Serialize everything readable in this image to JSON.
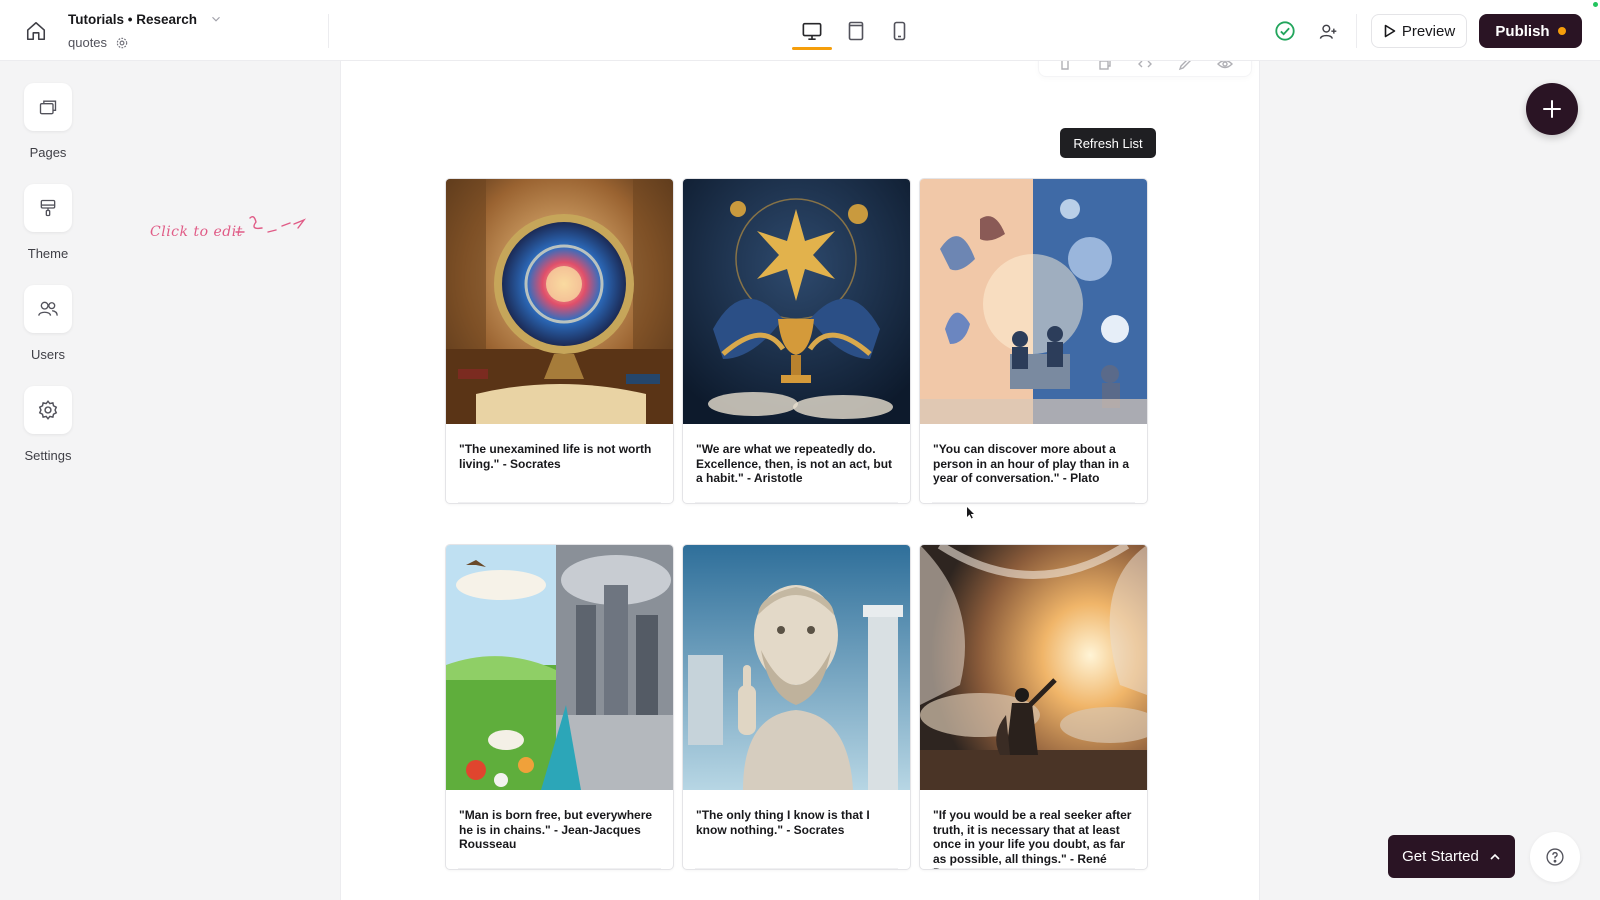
{
  "header": {
    "project_name": "Tutorials • Research",
    "app_name": "quotes",
    "preview_label": "Preview",
    "publish_label": "Publish",
    "accent": "#f59e0b",
    "brand_dark": "#2a1424"
  },
  "devices": [
    {
      "name": "desktop-view-icon",
      "active": true
    },
    {
      "name": "tablet-view-icon",
      "active": false
    },
    {
      "name": "mobile-view-icon",
      "active": false
    }
  ],
  "sidebar": {
    "items": [
      {
        "label": "Pages",
        "icon": "pages-icon"
      },
      {
        "label": "Theme",
        "icon": "theme-icon"
      },
      {
        "label": "Users",
        "icon": "users-icon"
      },
      {
        "label": "Settings",
        "icon": "gear-icon"
      }
    ]
  },
  "hint": {
    "text": "Click to edit"
  },
  "canvas": {
    "refresh_label": "Refresh List",
    "cards": [
      {
        "quote": "\"The unexamined life is not worth living.\" - Socrates",
        "image": "library-globe-illustration"
      },
      {
        "quote": "\"We are what we repeatedly do. Excellence, then, is not an act, but a habit.\" - Aristotle",
        "image": "golden-trophy-illustration"
      },
      {
        "quote": "\"You can discover more about a person in an hour of play than in a year of conversation.\" - Plato",
        "image": "play-conversation-illustration"
      },
      {
        "quote": "\"Man is born free, but everywhere he is in chains.\" - Jean-Jacques Rousseau",
        "image": "nature-city-illustration"
      },
      {
        "quote": "\"The only thing I know is that I know nothing.\" - Socrates",
        "image": "philosopher-bust-illustration"
      },
      {
        "quote": "\"If you would be a real seeker after truth, it is necessary that at least once in your life you doubt, as far as possible, all things.\" - René Descartes",
        "image": "veiled-light-illustration"
      }
    ]
  },
  "footer": {
    "get_started_label": "Get Started"
  }
}
